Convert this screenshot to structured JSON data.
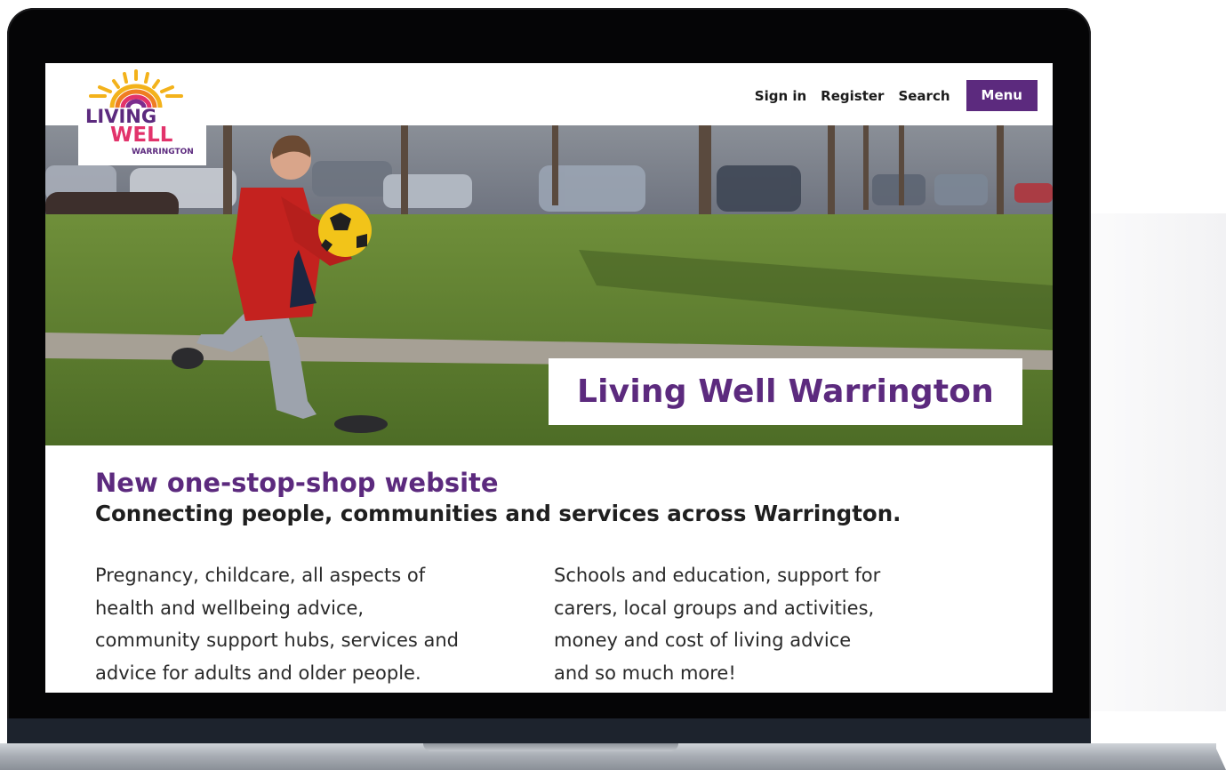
{
  "nav": {
    "sign_in": "Sign in",
    "register": "Register",
    "search": "Search",
    "menu": "Menu"
  },
  "logo": {
    "line1": "LIVING",
    "line2": "WELL",
    "line3": "WARRINGTON"
  },
  "hero": {
    "title": "Living Well Warrington"
  },
  "content": {
    "headline": "New one-stop-shop website",
    "subhead": "Connecting people, communities and services across Warrington.",
    "col_left": "Pregnancy, childcare, all aspects of\nhealth and wellbeing advice,\ncommunity support hubs, services and\nadvice for adults and older people.",
    "col_right": "Schools and education, support for\ncarers, local groups and activities,\nmoney and cost of living advice\nand so much more!"
  },
  "colors": {
    "brand_purple": "#5c2a7e",
    "laptop_bezel": "#050506"
  }
}
